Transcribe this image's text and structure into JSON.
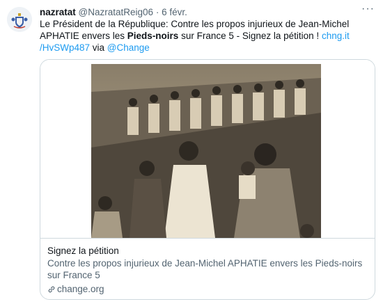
{
  "tweet": {
    "display_name": "nazratat",
    "handle": "@NazratatReig06",
    "separator": "·",
    "date": "6 févr.",
    "more_label": "···",
    "text_part1": "Le Président de la République: Contre les propos injurieux de Jean-Michel APHATIE envers les ",
    "text_bold": "Pieds-noirs",
    "text_part2": " sur France 5 - Signez la pétition ! ",
    "link_text": "chng.it /HvSWp487",
    "via_text": " via ",
    "mention": "@Change"
  },
  "card": {
    "title": "Signez la pétition",
    "description": "Contre les propos injurieux de Jean-Michel APHATIE envers les Pieds-noirs sur France 5",
    "domain": "change.org",
    "image_alt": "sepia photograph of people on a ship deck"
  },
  "colors": {
    "link": "#1d9bf0",
    "secondary_text": "#536471",
    "border": "#cfd9de"
  }
}
